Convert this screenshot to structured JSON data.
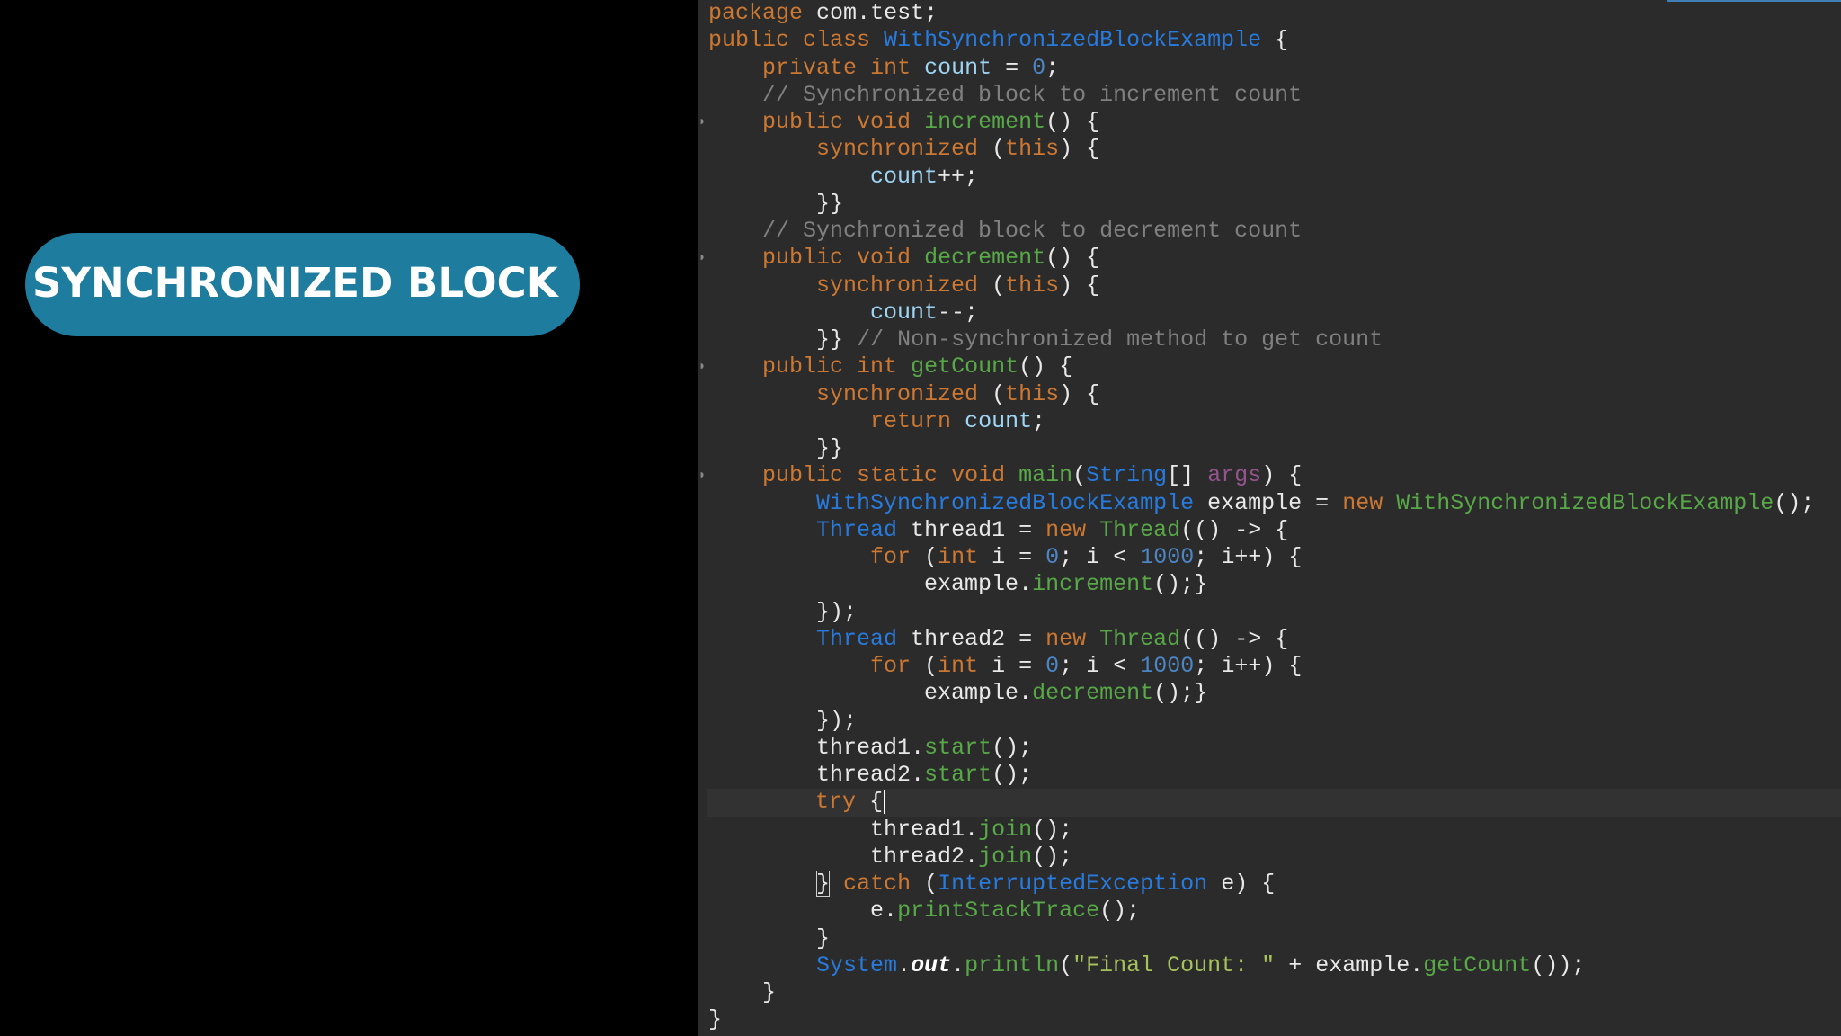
{
  "title_badge": {
    "text": "SYNCHRONIZED BLOCK",
    "color": "#1e7c9e"
  },
  "editor": {
    "theme": "dark",
    "background": "#2b2b2b",
    "current_line_index": 29,
    "caret_after_text": "try {",
    "lines": [
      "package com.test;",
      "public class WithSynchronizedBlockExample {",
      "    private int count = 0;",
      "    // Synchronized block to increment count",
      "    public void increment() {",
      "        synchronized (this) {",
      "            count++;",
      "        }}",
      "    // Synchronized block to decrement count",
      "    public void decrement() {",
      "        synchronized (this) {",
      "            count--;",
      "        }} // Non-synchronized method to get count",
      "    public int getCount() {",
      "        synchronized (this) {",
      "            return count;",
      "        }}",
      "    public static void main(String[] args) {",
      "        WithSynchronizedBlockExample example = new WithSynchronizedBlockExample();",
      "        Thread thread1 = new Thread(() -> {",
      "            for (int i = 0; i < 1000; i++) {",
      "                example.increment();}",
      "        });",
      "        Thread thread2 = new Thread(() -> {",
      "            for (int i = 0; i < 1000; i++) {",
      "                example.decrement();}",
      "        });",
      "        thread1.start();",
      "        thread2.start();",
      "        try {",
      "            thread1.join();",
      "            thread2.join();",
      "        } catch (InterruptedException e) {",
      "            e.printStackTrace();",
      "        }",
      "        System.out.println(\"Final Count: \" + example.getCount());",
      "    }",
      "}"
    ],
    "fold_markers_on_lines": [
      4,
      9,
      13,
      17
    ]
  }
}
